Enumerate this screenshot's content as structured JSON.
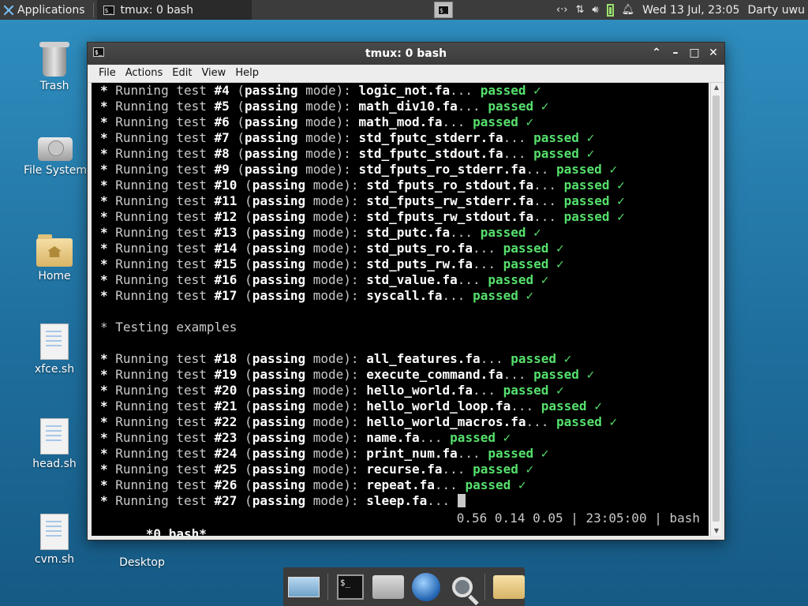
{
  "top_panel": {
    "applications_label": "Applications",
    "task_title": "tmux: 0 bash",
    "clock": "Wed 13 Jul, 23:05",
    "user": "Darty uwu"
  },
  "desktop": {
    "icons": [
      {
        "label": "Trash"
      },
      {
        "label": "File System"
      },
      {
        "label": "Home"
      },
      {
        "label": "xfce.sh"
      },
      {
        "label": "head.sh"
      },
      {
        "label": "cvm.sh"
      },
      {
        "label": "Desktop"
      }
    ]
  },
  "window": {
    "title": "tmux: 0 bash",
    "menu": [
      "File",
      "Actions",
      "Edit",
      "View",
      "Help"
    ]
  },
  "terminal": {
    "prefix": "* ",
    "running_label": "Running test ",
    "mode_open": "(",
    "mode_passing": "passing",
    "mode_close": " mode): ",
    "ellipsis": "...",
    "passed_label": "passed",
    "check": "✓",
    "section_heading": "* Testing examples",
    "tests_group1": [
      {
        "num": "#4",
        "file": "logic_not.fa"
      },
      {
        "num": "#5",
        "file": "math_div10.fa"
      },
      {
        "num": "#6",
        "file": "math_mod.fa"
      },
      {
        "num": "#7",
        "file": "std_fputc_stderr.fa"
      },
      {
        "num": "#8",
        "file": "std_fputc_stdout.fa"
      },
      {
        "num": "#9",
        "file": "std_fputs_ro_stderr.fa"
      },
      {
        "num": "#10",
        "file": "std_fputs_ro_stdout.fa"
      },
      {
        "num": "#11",
        "file": "std_fputs_rw_stderr.fa"
      },
      {
        "num": "#12",
        "file": "std_fputs_rw_stdout.fa"
      },
      {
        "num": "#13",
        "file": "std_putc.fa"
      },
      {
        "num": "#14",
        "file": "std_puts_ro.fa"
      },
      {
        "num": "#15",
        "file": "std_puts_rw.fa"
      },
      {
        "num": "#16",
        "file": "std_value.fa"
      },
      {
        "num": "#17",
        "file": "syscall.fa"
      }
    ],
    "tests_group2": [
      {
        "num": "#18",
        "file": "all_features.fa"
      },
      {
        "num": "#19",
        "file": "execute_command.fa"
      },
      {
        "num": "#20",
        "file": "hello_world.fa"
      },
      {
        "num": "#21",
        "file": "hello_world_loop.fa"
      },
      {
        "num": "#22",
        "file": "hello_world_macros.fa"
      },
      {
        "num": "#23",
        "file": "name.fa"
      },
      {
        "num": "#24",
        "file": "print_num.fa"
      },
      {
        "num": "#25",
        "file": "recurse.fa"
      },
      {
        "num": "#26",
        "file": "repeat.fa"
      }
    ],
    "running_test": {
      "num": "#27",
      "file": "sleep.fa"
    },
    "status_left": "*0 bash*",
    "status_right": "0.56 0.14 0.05 | 23:05:00 | bash"
  },
  "colors": {
    "passed": "#56e06c",
    "panel": "#3c3c3c",
    "desktop": "#1f6f9e"
  },
  "icons": [
    "xfce-logo-icon",
    "terminal-icon",
    "network-icon",
    "updown-arrows-icon",
    "volume-icon",
    "battery-icon",
    "notification-bell-icon",
    "globe-icon",
    "search-icon",
    "folder-icon",
    "home-icon"
  ]
}
